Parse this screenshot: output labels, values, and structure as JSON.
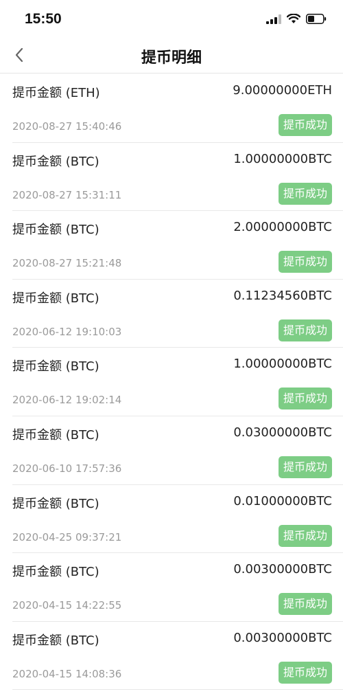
{
  "status_bar": {
    "time": "15:50",
    "icons": [
      "signal-icon",
      "wifi-icon",
      "battery-icon"
    ]
  },
  "header": {
    "title": "提币明细",
    "back_icon": "chevron-left-icon"
  },
  "colors": {
    "badge_background": "#7dcd85",
    "timestamp_text": "#9a9a9a",
    "divider": "#e8e8e8"
  },
  "records": [
    {
      "label": "提币金额 (ETH)",
      "amount": "9.00000000ETH",
      "time": "2020-08-27 15:40:46",
      "status": "提币成功"
    },
    {
      "label": "提币金额 (BTC)",
      "amount": "1.00000000BTC",
      "time": "2020-08-27 15:31:11",
      "status": "提币成功"
    },
    {
      "label": "提币金额 (BTC)",
      "amount": "2.00000000BTC",
      "time": "2020-08-27 15:21:48",
      "status": "提币成功"
    },
    {
      "label": "提币金额 (BTC)",
      "amount": "0.11234560BTC",
      "time": "2020-06-12 19:10:03",
      "status": "提币成功"
    },
    {
      "label": "提币金额 (BTC)",
      "amount": "1.00000000BTC",
      "time": "2020-06-12 19:02:14",
      "status": "提币成功"
    },
    {
      "label": "提币金额 (BTC)",
      "amount": "0.03000000BTC",
      "time": "2020-06-10 17:57:36",
      "status": "提币成功"
    },
    {
      "label": "提币金额 (BTC)",
      "amount": "0.01000000BTC",
      "time": "2020-04-25 09:37:21",
      "status": "提币成功"
    },
    {
      "label": "提币金额 (BTC)",
      "amount": "0.00300000BTC",
      "time": "2020-04-15 14:22:55",
      "status": "提币成功"
    },
    {
      "label": "提币金额 (BTC)",
      "amount": "0.00300000BTC",
      "time": "2020-04-15 14:08:36",
      "status": "提币成功"
    }
  ]
}
